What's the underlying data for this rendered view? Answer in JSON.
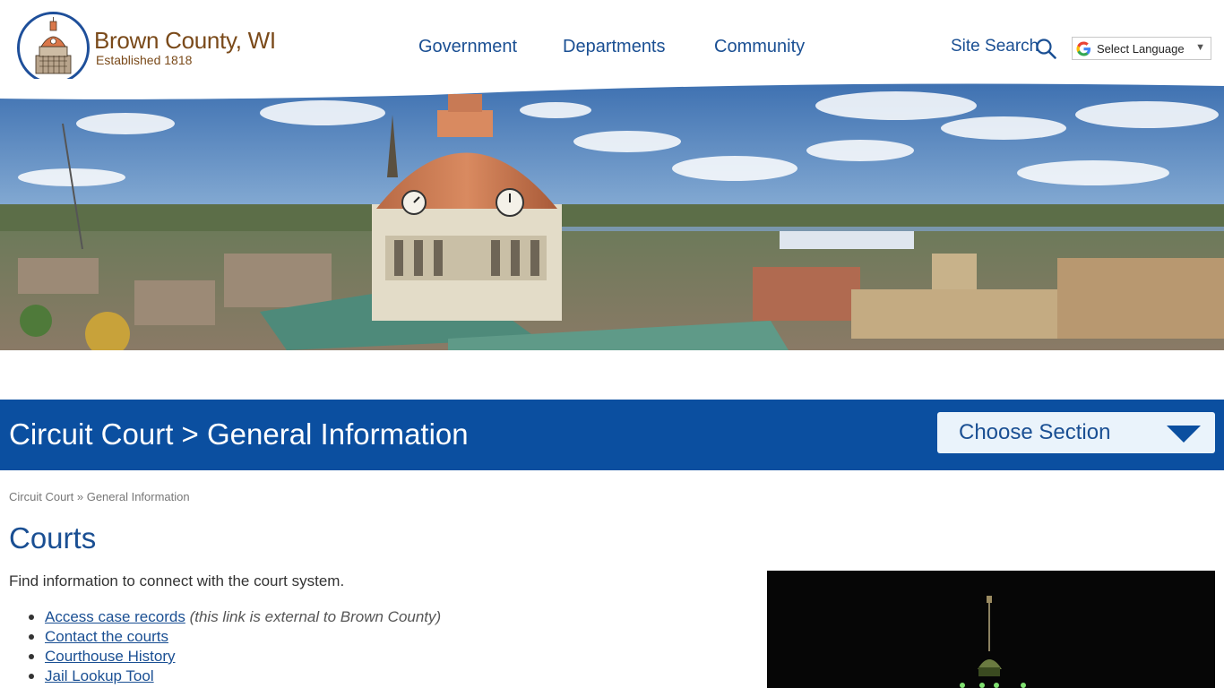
{
  "header": {
    "site_name": "Brown County, WI",
    "established": "Established 1818",
    "nav": [
      {
        "label": "Government"
      },
      {
        "label": "Departments"
      },
      {
        "label": "Community"
      }
    ],
    "site_search_label": "Site Search",
    "language": {
      "selected": "Select Language"
    }
  },
  "banner": {
    "title": "Circuit Court > General Information",
    "choose_section_label": "Choose Section"
  },
  "breadcrumb": {
    "items": [
      "Circuit Court",
      "General Information"
    ],
    "separator": "»"
  },
  "main": {
    "title": "Courts",
    "intro": "Find information to connect with the court system.",
    "links": [
      {
        "label": "Access case records",
        "note": "(this link is external to Brown County)"
      },
      {
        "label": "Contact the courts",
        "note": ""
      },
      {
        "label": "Courthouse History",
        "note": ""
      },
      {
        "label": "Jail Lookup Tool",
        "note": ""
      }
    ]
  },
  "colors": {
    "brand_blue": "#0b4fa0",
    "link_blue": "#1a4f93",
    "logo_brown": "#7a4a1a",
    "choose_bg": "#eaf3fb"
  },
  "icons": {
    "search": "search-icon",
    "google": "google-icon",
    "choose_arrow": "chevron-down-icon",
    "seal": "county-seal-logo"
  }
}
